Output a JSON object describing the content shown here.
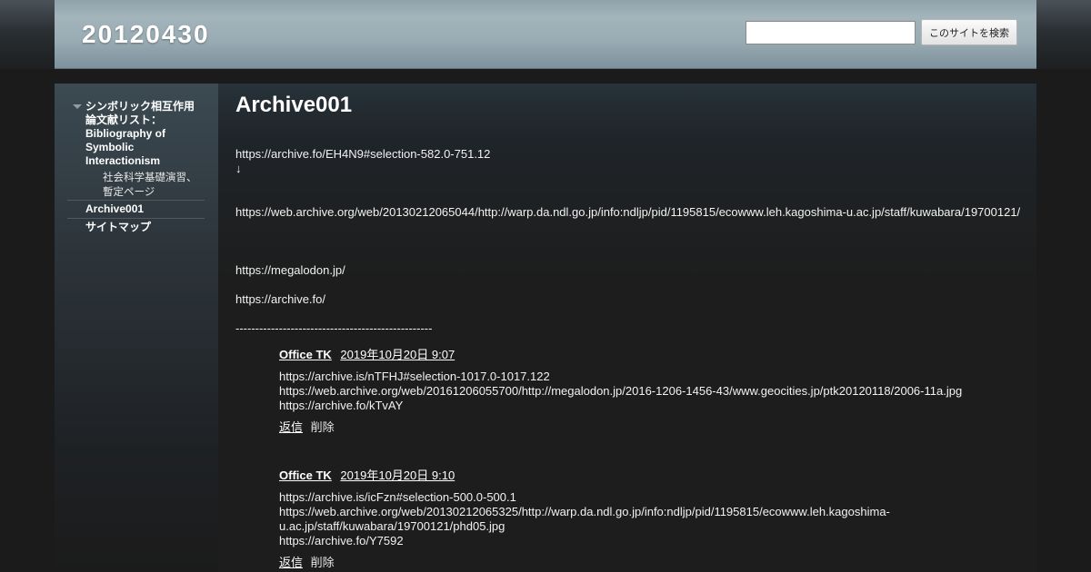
{
  "header": {
    "site_title": "20120430",
    "search": {
      "value": "",
      "button_label": "このサイトを検索"
    }
  },
  "sidebar": {
    "items": [
      {
        "label": "シンボリック相互作用論文献リスト：Bibliography of Symbolic Interactionism",
        "expanded": true
      },
      {
        "label": "社会科学基礎演習、暫定ページ",
        "level": 2
      },
      {
        "label": "Archive001"
      },
      {
        "label": "サイトマップ"
      }
    ]
  },
  "main": {
    "page_title": "Archive001",
    "lines": [
      "https://archive.fo/EH4N9#selection-582.0-751.12",
      "↓",
      "https://web.archive.org/web/20130212065044/http://warp.da.ndl.go.jp/info:ndljp/pid/1195815/ecowww.leh.kagoshima-u.ac.jp/staff/kuwabara/19700121/",
      "https://megalodon.jp/",
      "https://archive.fo/",
      "--------------------------------------------------"
    ],
    "comments": [
      {
        "author": "Office TK",
        "timestamp": "2019年10月20日 9:07",
        "lines": [
          "https://archive.is/nTFHJ#selection-1017.0-1017.122",
          "https://web.archive.org/web/20161206055700/http://megalodon.jp/2016-1206-1456-43/www.geocities.jp/ptk20120118/2006-11a.jpg",
          "https://archive.fo/kTvAY"
        ],
        "reply_label": "返信",
        "delete_label": "削除"
      },
      {
        "author": "Office TK",
        "timestamp": "2019年10月20日 9:10",
        "lines": [
          "https://archive.is/icFzn#selection-500.0-500.1",
          "https://web.archive.org/web/20130212065325/http://warp.da.ndl.go.jp/info:ndljp/pid/1195815/ecowww.leh.kagoshima-",
          "u.ac.jp/staff/kuwabara/19700121/phd05.jpg",
          "https://archive.fo/Y7592"
        ],
        "reply_label": "返信",
        "delete_label": "削除"
      }
    ]
  },
  "colors": {
    "page_background": "#1b1b1b",
    "header_background": "#a3b4bb",
    "text": "#ffffff"
  }
}
